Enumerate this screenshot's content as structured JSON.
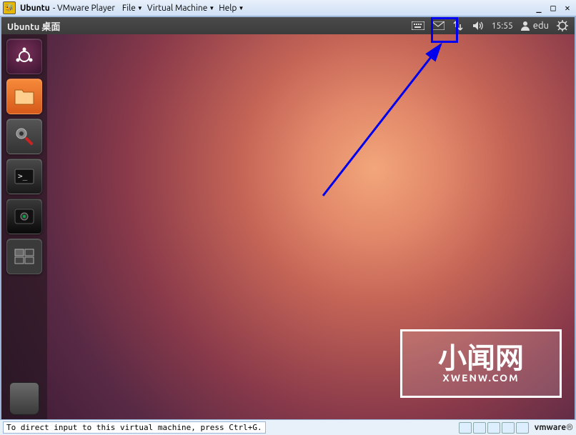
{
  "vmware": {
    "title_prefix": "Ubuntu",
    "title_suffix": "- VMware Player",
    "menu": {
      "file": "File",
      "vm": "Virtual Machine",
      "help": "Help"
    },
    "status_msg": "To direct input to this virtual machine, press Ctrl+G.",
    "logo": "vmware"
  },
  "ubuntu": {
    "topbar_title": "Ubuntu 桌面",
    "time": "15:55",
    "user": "edu"
  },
  "icons": {
    "keyboard": "keyboard-icon",
    "mail": "mail-icon",
    "network": "network-icon",
    "volume": "volume-icon",
    "user": "user-icon",
    "power": "power-icon"
  },
  "watermark": {
    "big": "小闻网",
    "small": "XWENW.COM"
  },
  "launcher": {
    "items": [
      {
        "name": "dash-home",
        "label": "Dash Home"
      },
      {
        "name": "files",
        "label": "Files"
      },
      {
        "name": "settings",
        "label": "System Settings"
      },
      {
        "name": "terminal",
        "label": "Terminal"
      },
      {
        "name": "webcam",
        "label": "Camera"
      },
      {
        "name": "workspace",
        "label": "Workspace Switcher"
      }
    ],
    "trash": "Trash"
  },
  "highlight_target": "network-indicator"
}
